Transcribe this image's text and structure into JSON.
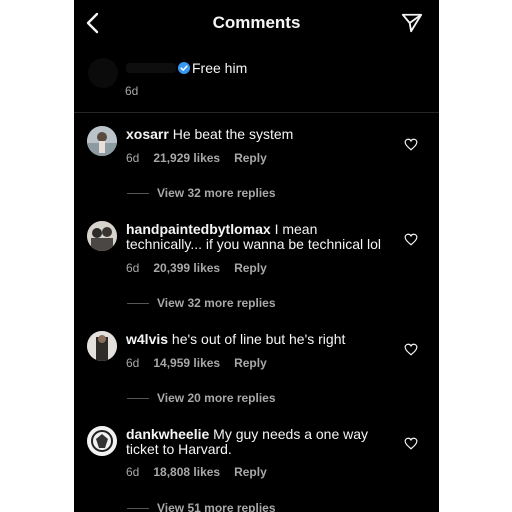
{
  "header": {
    "title": "Comments",
    "back_icon": "chevron-left-icon",
    "share_icon": "paper-plane-icon"
  },
  "top_comment": {
    "text": "Free him",
    "time": "6d",
    "verified_icon": "verified-badge-icon"
  },
  "comments": [
    {
      "username": "xosarr",
      "text": "He beat the system",
      "time": "6d",
      "likes": "21,929 likes",
      "reply": "Reply",
      "view_replies": "View 32 more replies"
    },
    {
      "username": "handpaintedbytlomax",
      "text": "I mean technically... if you wanna be technical lol",
      "time": "6d",
      "likes": "20,399 likes",
      "reply": "Reply",
      "view_replies": "View 32 more replies"
    },
    {
      "username": "w4lvis",
      "text": "he's out of line but he's right",
      "time": "6d",
      "likes": "14,959 likes",
      "reply": "Reply",
      "view_replies": "View 20 more replies"
    },
    {
      "username": "dankwheelie",
      "text": "My guy needs a one way ticket to Harvard.",
      "time": "6d",
      "likes": "18,808 likes",
      "reply": "Reply",
      "view_replies": "View 51 more replies"
    }
  ],
  "colors": {
    "background": "#000000",
    "text": "#f5f5f5",
    "secondary": "#a8a8a8",
    "verified": "#3897f0"
  }
}
